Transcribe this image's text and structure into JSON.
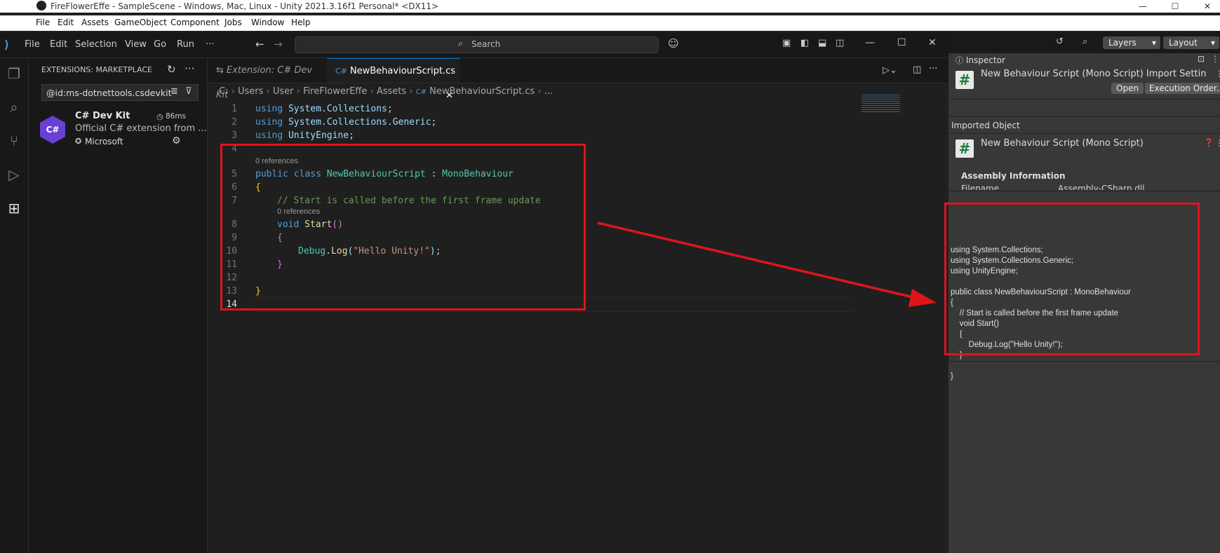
{
  "unity": {
    "title": "FireFlowerEffe - SampleScene - Windows, Mac, Linux - Unity 2021.3.16f1 Personal* <DX11>",
    "menu": [
      "File",
      "Edit",
      "Assets",
      "GameObject",
      "Component",
      "Jobs",
      "Window",
      "Help"
    ],
    "toolbar": {
      "layers": "Layers",
      "layout": "Layout"
    },
    "inspector": {
      "tab": "Inspector",
      "header_title": "New Behaviour Script (Mono Script) Import Settin",
      "open_button": "Open",
      "execution_order_button": "Execution Order...",
      "imported_object_label": "Imported Object",
      "object_name": "New Behaviour Script (Mono Script)",
      "assembly_info": "Assembly Information",
      "filename_label": "Filename",
      "filename_value": "Assembly-CSharp.dll",
      "preview": "using System.Collections;\nusing System.Collections.Generic;\nusing UnityEngine;\n\npublic class NewBehaviourScript : MonoBehaviour\n{\n    // Start is called before the first frame update\n    void Start()\n    {\n        Debug.Log(\"Hello Unity!\");\n    }\n\n}"
    }
  },
  "vscode": {
    "menu": [
      "File",
      "Edit",
      "Selection",
      "View",
      "Go",
      "Run",
      "···"
    ],
    "search_placeholder": "Search",
    "sidebar": {
      "title": "EXTENSIONS: MARKETPLACE",
      "search_value": "@id:ms-dotnettools.csdevkit",
      "extension": {
        "name": "C# Dev Kit",
        "timing": "86ms",
        "description": "Official C# extension from ...",
        "publisher": "Microsoft",
        "icon_text": "C#"
      }
    },
    "tabs": [
      {
        "label": "Extension: C# Dev Kit"
      },
      {
        "label": "NewBehaviourScript.cs"
      }
    ],
    "breadcrumb": [
      "C:",
      "Users",
      "User",
      "FireFlowerEffe",
      "Assets",
      "NewBehaviourScript.cs",
      "..."
    ],
    "code": {
      "line_numbers": [
        "1",
        "2",
        "3",
        "4",
        "5",
        "6",
        "7",
        "8",
        "9",
        "10",
        "11",
        "12",
        "13",
        "14"
      ],
      "using1": "System.Collections",
      "using2": "System.Collections.Generic",
      "using3": "UnityEngine",
      "references": "0 references",
      "class_name": "NewBehaviourScript",
      "base_class": "MonoBehaviour",
      "comment": "// Start is called before the first frame update",
      "method": "Start",
      "call_obj": "Debug",
      "call_fn": "Log",
      "string_literal": "\"Hello Unity!\""
    }
  }
}
